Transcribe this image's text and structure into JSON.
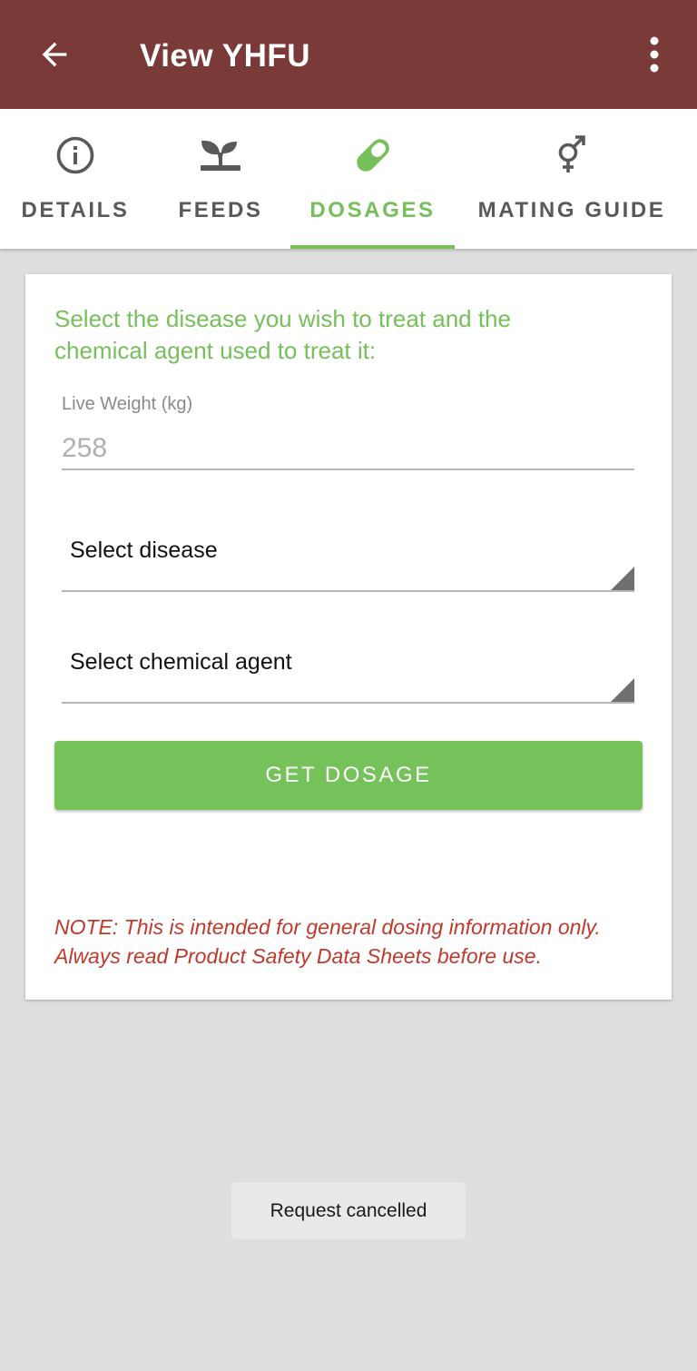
{
  "app_bar": {
    "title": "View YHFU",
    "background_color": "#7a3b38",
    "back_icon": "arrow-left-icon",
    "more_icon": "more-vert-icon"
  },
  "tabs": [
    {
      "label": "DETAILS",
      "icon": "info-icon",
      "active": false
    },
    {
      "label": "FEEDS",
      "icon": "sprout-icon",
      "active": false
    },
    {
      "label": "DOSAGES",
      "icon": "pill-icon",
      "active": true
    },
    {
      "label": "MATING GUIDE",
      "icon": "gender-icon",
      "active": false
    }
  ],
  "accent_color": "#76bf5a",
  "dosage_form": {
    "instructions": "Select the disease you wish to treat and the chemical agent used to treat it:",
    "live_weight_label": "Live Weight (kg)",
    "live_weight_value": "258",
    "disease_select": "Select disease",
    "chemical_select": "Select chemical agent",
    "get_dosage_label": "GET DOSAGE",
    "note": "NOTE: This is intended for general dosing information only. Always read Product Safety Data Sheets before use."
  },
  "toast": {
    "message": "Request cancelled"
  }
}
